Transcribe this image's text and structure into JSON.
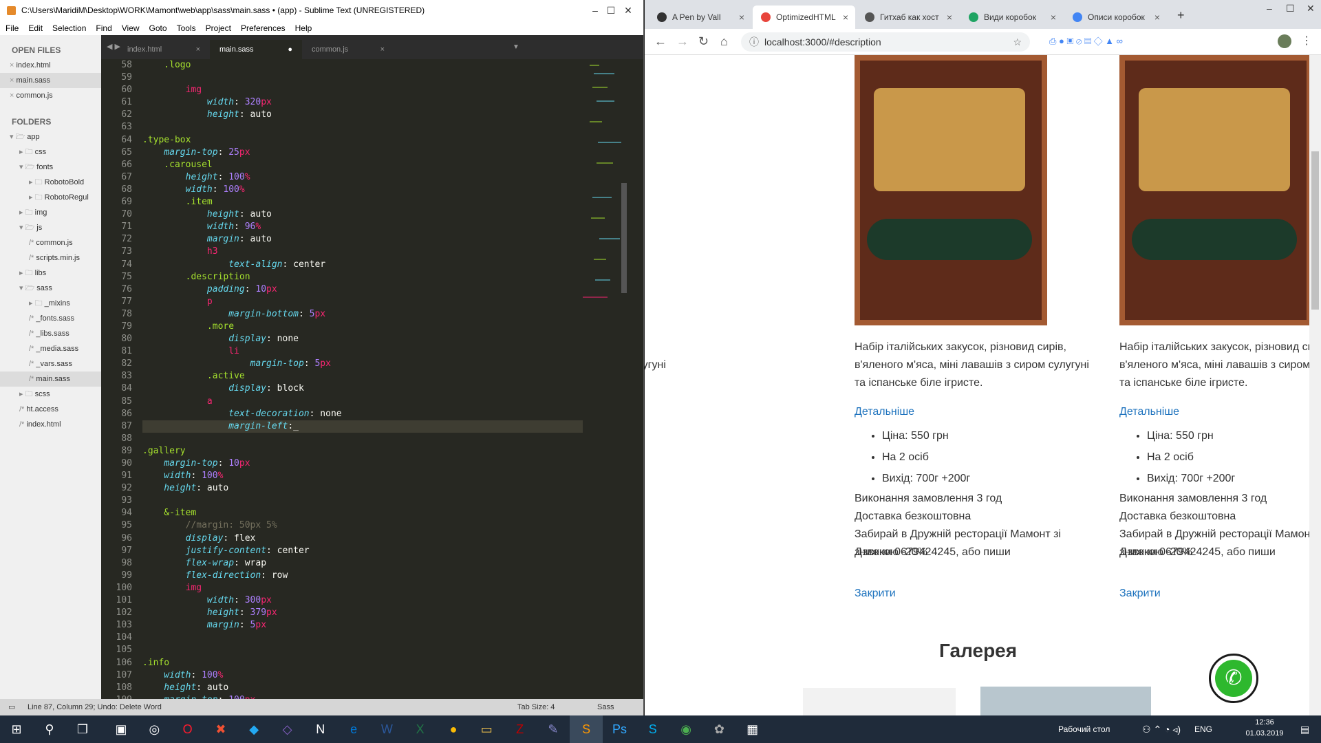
{
  "sublime": {
    "title": "C:\\Users\\MaridiM\\Desktop\\WORK\\Mamont\\web\\app\\sass\\main.sass • (app) - Sublime Text (UNREGISTERED)",
    "menu": [
      "File",
      "Edit",
      "Selection",
      "Find",
      "View",
      "Goto",
      "Tools",
      "Project",
      "Preferences",
      "Help"
    ],
    "open_files_label": "OPEN FILES",
    "open_files": [
      "index.html",
      "main.sass",
      "common.js"
    ],
    "folders_label": "FOLDERS",
    "folders": [
      {
        "d": 0,
        "n": "app",
        "t": "open"
      },
      {
        "d": 1,
        "n": "css",
        "t": "folder"
      },
      {
        "d": 1,
        "n": "fonts",
        "t": "open"
      },
      {
        "d": 2,
        "n": "RobotoBold",
        "t": "folder"
      },
      {
        "d": 2,
        "n": "RobotoRegul",
        "t": "folder"
      },
      {
        "d": 1,
        "n": "img",
        "t": "folder"
      },
      {
        "d": 1,
        "n": "js",
        "t": "open"
      },
      {
        "d": 2,
        "n": "common.js",
        "t": "file"
      },
      {
        "d": 2,
        "n": "scripts.min.js",
        "t": "file"
      },
      {
        "d": 1,
        "n": "libs",
        "t": "folder"
      },
      {
        "d": 1,
        "n": "sass",
        "t": "open"
      },
      {
        "d": 2,
        "n": "_mixins",
        "t": "folder"
      },
      {
        "d": 2,
        "n": "_fonts.sass",
        "t": "file"
      },
      {
        "d": 2,
        "n": "_libs.sass",
        "t": "file"
      },
      {
        "d": 2,
        "n": "_media.sass",
        "t": "file"
      },
      {
        "d": 2,
        "n": "_vars.sass",
        "t": "file"
      },
      {
        "d": 2,
        "n": "main.sass",
        "t": "file",
        "sel": true
      },
      {
        "d": 1,
        "n": "scss",
        "t": "folder"
      },
      {
        "d": 1,
        "n": "ht.access",
        "t": "file"
      },
      {
        "d": 1,
        "n": "index.html",
        "t": "file"
      }
    ],
    "tabs": [
      "index.html",
      "main.sass",
      "common.js"
    ],
    "lines": [
      [
        58,
        [
          [
            "    .logo",
            "s"
          ]
        ]
      ],
      [
        59,
        []
      ],
      [
        60,
        [
          [
            "        img",
            "k"
          ]
        ]
      ],
      [
        61,
        [
          [
            "            width",
            "p"
          ],
          [
            ": ",
            ""
          ],
          [
            "320",
            "n"
          ],
          [
            "px",
            "k"
          ]
        ]
      ],
      [
        62,
        [
          [
            "            height",
            "p"
          ],
          [
            ": auto",
            ""
          ]
        ]
      ],
      [
        63,
        []
      ],
      [
        64,
        [
          [
            ".type-box",
            "s"
          ]
        ]
      ],
      [
        65,
        [
          [
            "    margin-top",
            "p"
          ],
          [
            ": ",
            ""
          ],
          [
            "25",
            "n"
          ],
          [
            "px",
            "k"
          ]
        ]
      ],
      [
        66,
        [
          [
            "    .carousel",
            "s"
          ]
        ]
      ],
      [
        67,
        [
          [
            "        height",
            "p"
          ],
          [
            ": ",
            ""
          ],
          [
            "100",
            "n"
          ],
          [
            "%",
            "k"
          ]
        ]
      ],
      [
        68,
        [
          [
            "        width",
            "p"
          ],
          [
            ": ",
            ""
          ],
          [
            "100",
            "n"
          ],
          [
            "%",
            "k"
          ]
        ]
      ],
      [
        69,
        [
          [
            "        .item",
            "s"
          ]
        ]
      ],
      [
        70,
        [
          [
            "            height",
            "p"
          ],
          [
            ": auto",
            ""
          ]
        ]
      ],
      [
        71,
        [
          [
            "            width",
            "p"
          ],
          [
            ": ",
            ""
          ],
          [
            "96",
            "n"
          ],
          [
            "%",
            "k"
          ]
        ]
      ],
      [
        72,
        [
          [
            "            margin",
            "p"
          ],
          [
            ": auto",
            ""
          ]
        ]
      ],
      [
        73,
        [
          [
            "            h3",
            "k"
          ]
        ]
      ],
      [
        74,
        [
          [
            "                text-align",
            "p"
          ],
          [
            ": center",
            ""
          ]
        ]
      ],
      [
        75,
        [
          [
            "        .description",
            "s"
          ]
        ]
      ],
      [
        76,
        [
          [
            "            padding",
            "p"
          ],
          [
            ": ",
            ""
          ],
          [
            "10",
            "n"
          ],
          [
            "px",
            "k"
          ]
        ]
      ],
      [
        77,
        [
          [
            "            p",
            "k"
          ]
        ]
      ],
      [
        78,
        [
          [
            "                margin-bottom",
            "p"
          ],
          [
            ": ",
            ""
          ],
          [
            "5",
            "n"
          ],
          [
            "px",
            "k"
          ]
        ]
      ],
      [
        79,
        [
          [
            "            .more",
            "s"
          ]
        ]
      ],
      [
        80,
        [
          [
            "                display",
            "p"
          ],
          [
            ": none",
            ""
          ]
        ]
      ],
      [
        81,
        [
          [
            "                li",
            "k"
          ]
        ]
      ],
      [
        82,
        [
          [
            "                    margin-top",
            "p"
          ],
          [
            ": ",
            ""
          ],
          [
            "5",
            "n"
          ],
          [
            "px",
            "k"
          ]
        ]
      ],
      [
        83,
        [
          [
            "            .active",
            "s"
          ]
        ]
      ],
      [
        84,
        [
          [
            "                display",
            "p"
          ],
          [
            ": block",
            ""
          ]
        ]
      ],
      [
        85,
        [
          [
            "            a",
            "k"
          ]
        ]
      ],
      [
        86,
        [
          [
            "                text-decoration",
            "p"
          ],
          [
            ": none",
            ""
          ]
        ]
      ],
      [
        87,
        [
          [
            "                margin-left",
            "p"
          ],
          [
            ":_",
            ""
          ]
        ]
      ],
      [
        88,
        []
      ],
      [
        89,
        [
          [
            ".gallery",
            "s"
          ]
        ]
      ],
      [
        90,
        [
          [
            "    margin-top",
            "p"
          ],
          [
            ": ",
            ""
          ],
          [
            "10",
            "n"
          ],
          [
            "px",
            "k"
          ]
        ]
      ],
      [
        91,
        [
          [
            "    width",
            "p"
          ],
          [
            ": ",
            ""
          ],
          [
            "100",
            "n"
          ],
          [
            "%",
            "k"
          ]
        ]
      ],
      [
        92,
        [
          [
            "    height",
            "p"
          ],
          [
            ": auto",
            ""
          ]
        ]
      ],
      [
        93,
        []
      ],
      [
        94,
        [
          [
            "    &-item",
            "s"
          ]
        ]
      ],
      [
        95,
        [
          [
            "        //margin: 50px 5%",
            "c"
          ]
        ]
      ],
      [
        96,
        [
          [
            "        display",
            "p"
          ],
          [
            ": flex",
            ""
          ]
        ]
      ],
      [
        97,
        [
          [
            "        justify-content",
            "p"
          ],
          [
            ": center",
            ""
          ]
        ]
      ],
      [
        98,
        [
          [
            "        flex-wrap",
            "p"
          ],
          [
            ": wrap",
            ""
          ]
        ]
      ],
      [
        99,
        [
          [
            "        flex-direction",
            "p"
          ],
          [
            ": row",
            ""
          ]
        ]
      ],
      [
        100,
        [
          [
            "        img",
            "k"
          ]
        ]
      ],
      [
        101,
        [
          [
            "            width",
            "p"
          ],
          [
            ": ",
            ""
          ],
          [
            "300",
            "n"
          ],
          [
            "px",
            "k"
          ]
        ]
      ],
      [
        102,
        [
          [
            "            height",
            "p"
          ],
          [
            ": ",
            ""
          ],
          [
            "379",
            "n"
          ],
          [
            "px",
            "k"
          ]
        ]
      ],
      [
        103,
        [
          [
            "            margin",
            "p"
          ],
          [
            ": ",
            ""
          ],
          [
            "5",
            "n"
          ],
          [
            "px",
            "k"
          ]
        ]
      ],
      [
        104,
        []
      ],
      [
        105,
        []
      ],
      [
        106,
        [
          [
            ".info",
            "s"
          ]
        ]
      ],
      [
        107,
        [
          [
            "    width",
            "p"
          ],
          [
            ": ",
            ""
          ],
          [
            "100",
            "n"
          ],
          [
            "%",
            "k"
          ]
        ]
      ],
      [
        108,
        [
          [
            "    height",
            "p"
          ],
          [
            ": auto",
            ""
          ]
        ]
      ],
      [
        109,
        [
          [
            "    margin-top",
            "p"
          ],
          [
            ": ",
            ""
          ],
          [
            "100",
            "n"
          ],
          [
            "px",
            "k"
          ]
        ]
      ]
    ],
    "status": "Line 87, Column 29; Undo: Delete Word",
    "tabsize": "Tab Size: 4",
    "syntax": "Sass"
  },
  "browser": {
    "tabs": [
      {
        "label": "A Pen by Vall",
        "color": "#333"
      },
      {
        "label": "OptimizedHTML",
        "color": "#e8453c",
        "active": true
      },
      {
        "label": "Гитхаб как хост",
        "color": "#555"
      },
      {
        "label": "Види коробок",
        "color": "#1fa463"
      },
      {
        "label": "Описи коробок",
        "color": "#4285f4"
      }
    ],
    "url": "localhost:3000/#description",
    "card_desc": "Набір італійських закусок, різновид сирів, в'яленого м'яса, міні лавашів з сиром сулугуні та іспанське біле ігристе.",
    "more": "Детальніше",
    "li": [
      "Ціна: 550 грн",
      "На 2 осіб",
      "Вихід: 700г +200г"
    ],
    "info": [
      "Виконання замовлення 3 год",
      "Доставка безкоштовна",
      "Забирай в Дружній ресторації Мамонт зі знижкою -20%",
      "Дзвони 0679424245, або пиши"
    ],
    "close": "Закрити",
    "gallery": "Галерея",
    "call_icon": "phone-icon"
  },
  "taskbar": {
    "desktop": "Рабочий стол",
    "lang": "ENG",
    "time": "12:36",
    "date": "01.03.2019"
  }
}
